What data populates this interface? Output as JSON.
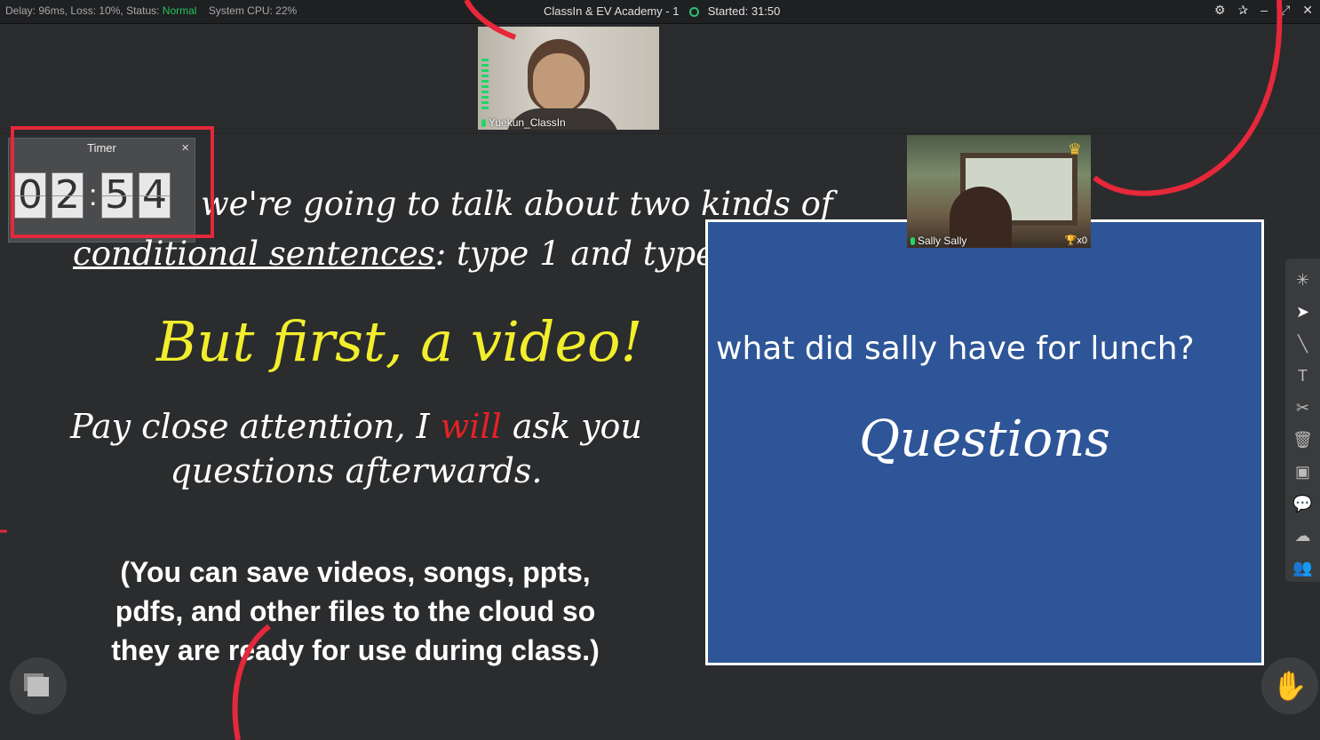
{
  "status_bar": {
    "delay": "Delay: 96ms,",
    "loss": "Loss: 10%,",
    "status_prefix": "Status:",
    "status_value": "Normal",
    "cpu": "System CPU: 22%",
    "title": "ClassIn & EV Academy - 1",
    "started": "Started: 31:50"
  },
  "teacher_cam": {
    "name": "Yuekun_ClassIn"
  },
  "student_cam": {
    "name": "Sally Sally",
    "trophies": "x0"
  },
  "timer": {
    "title": "Timer",
    "close": "×",
    "digits": [
      "0",
      "2",
      "5",
      "4"
    ],
    "colon": ":"
  },
  "slide": {
    "line1": "we're going to talk about two kinds of",
    "line2_underlined": "conditional sentences",
    "line2_rest": ": type 1 and type 2.",
    "headline": "But first, a video!",
    "pay_before": "Pay close attention, I ",
    "pay_red": "will",
    "pay_after": " ask you questions afterwards.",
    "note": "(You can save videos, songs, ppts, pdfs, and other files to the cloud so they are ready for use during class.)"
  },
  "board": {
    "question": "what did sally have for lunch?",
    "title": "Questions"
  },
  "toolbar": {
    "icons": [
      "laser-pointer-icon",
      "select-move-icon",
      "pen-icon",
      "text-icon",
      "scissors-icon",
      "trash-icon",
      "formula-icon",
      "chat-icon",
      "cloud-icon",
      "users-icon"
    ]
  },
  "colors": {
    "status_ok": "#22c55e",
    "yellow_headline": "#f2ee2c",
    "red_word": "#e52224",
    "board_blue": "#2e5597",
    "annotation_red": "#e5283a"
  }
}
